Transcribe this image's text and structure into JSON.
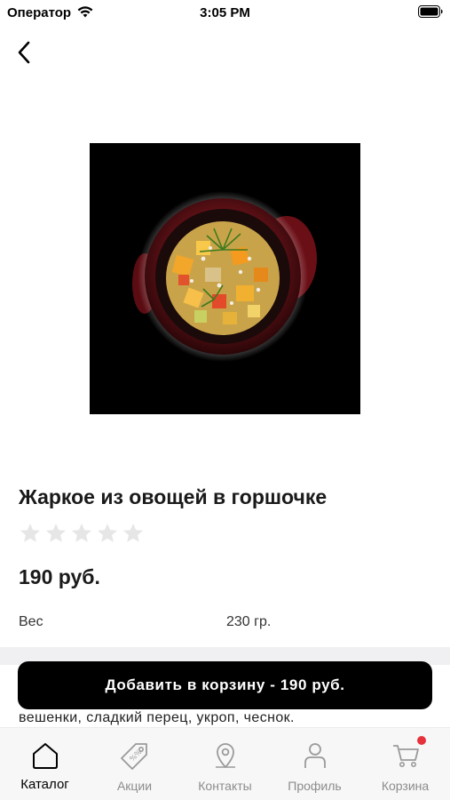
{
  "status_bar": {
    "carrier": "Оператор",
    "time": "3:05 PM"
  },
  "product": {
    "title": "Жаркое из овощей в горшочке",
    "rating": 0,
    "rating_max": 5,
    "price": "190 руб.",
    "weight_label": "Вес",
    "weight_value": "230 гр.",
    "description_visible": "вешенки, сладкий перец, укроп, чеснок."
  },
  "actions": {
    "add_to_cart_label": "Добавить в корзину - 190 руб."
  },
  "tab_bar": {
    "items": [
      {
        "label": "Каталог",
        "icon": "home-icon",
        "active": true
      },
      {
        "label": "Акции",
        "icon": "tag-icon",
        "active": false
      },
      {
        "label": "Контакты",
        "icon": "location-pin-icon",
        "active": false
      },
      {
        "label": "Профиль",
        "icon": "person-icon",
        "active": false
      },
      {
        "label": "Корзина",
        "icon": "cart-icon",
        "active": false,
        "has_badge": true
      }
    ]
  },
  "colors": {
    "primary": "#000000",
    "badge": "#e5323b",
    "inactive_tab": "#8c8c8c",
    "star_empty": "#e6e6e6"
  }
}
